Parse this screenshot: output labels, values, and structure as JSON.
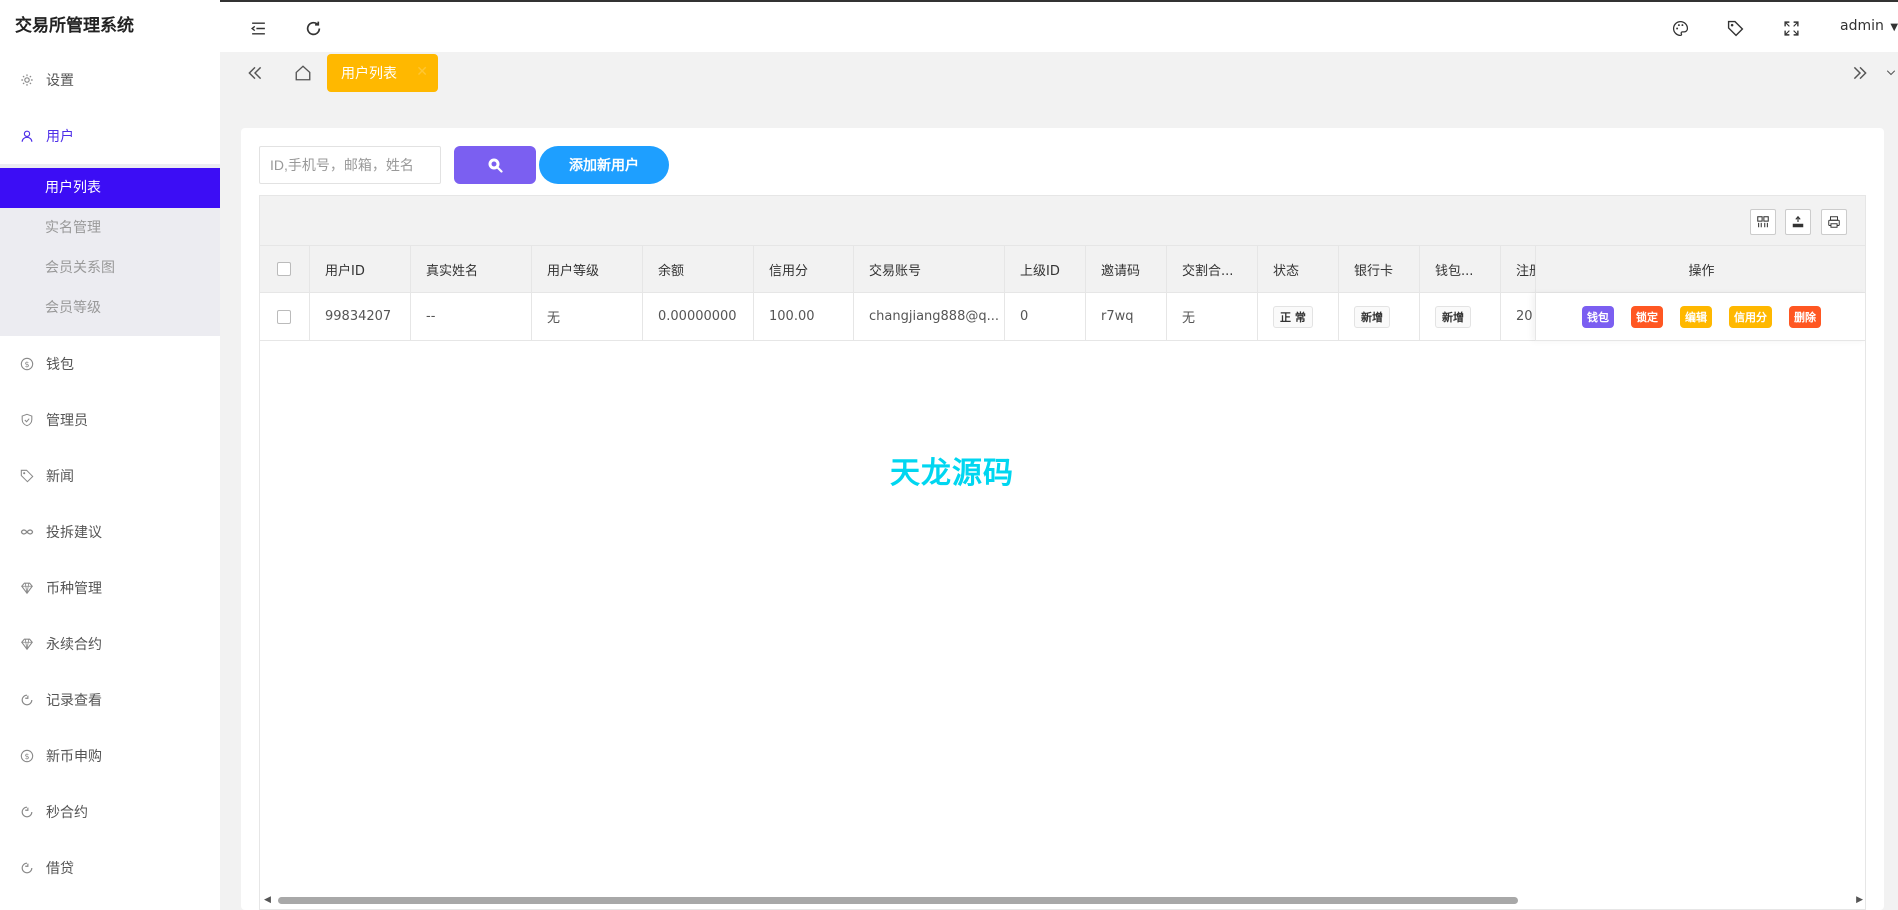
{
  "app": {
    "title": "交易所管理系统"
  },
  "sidebar": {
    "items": [
      {
        "label": "设置",
        "icon": "gear-icon"
      },
      {
        "label": "用户",
        "icon": "user-icon",
        "open": true,
        "children": [
          {
            "label": "用户列表",
            "active": true
          },
          {
            "label": "实名管理"
          },
          {
            "label": "会员关系图"
          },
          {
            "label": "会员等级"
          }
        ]
      },
      {
        "label": "钱包",
        "icon": "dollar-icon"
      },
      {
        "label": "管理员",
        "icon": "shield-icon"
      },
      {
        "label": "新闻",
        "icon": "tag-icon"
      },
      {
        "label": "投拆建议",
        "icon": "link-icon"
      },
      {
        "label": "币种管理",
        "icon": "diamond-icon"
      },
      {
        "label": "永续合约",
        "icon": "diamond-icon"
      },
      {
        "label": "记录查看",
        "icon": "refresh-icon"
      },
      {
        "label": "新币申购",
        "icon": "dollar-icon"
      },
      {
        "label": "秒合约",
        "icon": "refresh-icon"
      },
      {
        "label": "借贷",
        "icon": "refresh-icon"
      }
    ]
  },
  "topbar": {
    "user": "admin"
  },
  "tabs": [
    {
      "label": "用户列表",
      "active": true
    }
  ],
  "search": {
    "placeholder": "ID,手机号，邮箱，姓名",
    "value": ""
  },
  "actions": {
    "add_user": "添加新用户"
  },
  "table": {
    "columns": [
      "用户ID",
      "真实姓名",
      "用户等级",
      "余额",
      "信用分",
      "交易账号",
      "上级ID",
      "邀请码",
      "交割合...",
      "状态",
      "银行卡",
      "钱包...",
      "注册"
    ],
    "ops_header": "操作",
    "rows": [
      {
        "cells": [
          "99834207",
          "--",
          "无",
          "0.00000000",
          "100.00",
          "changjiang888@q...",
          "0",
          "r7wq",
          "无"
        ],
        "status": "正 常",
        "bank": "新增",
        "wallet": "新增",
        "reg": "20"
      }
    ],
    "row_ops": [
      {
        "label": "钱包",
        "color": "#7b5ff1"
      },
      {
        "label": "锁定",
        "color": "#ff5722"
      },
      {
        "label": "编辑",
        "color": "#ffb800"
      },
      {
        "label": "信用分",
        "color": "#ffb800"
      },
      {
        "label": "删除",
        "color": "#ff5722"
      }
    ]
  },
  "watermark": "天龙源码",
  "colors": {
    "accent": "#3c0df5",
    "tab_active": "#ffb800",
    "primary_blue": "#1e9fff",
    "search_btn": "#7b5ff1"
  }
}
